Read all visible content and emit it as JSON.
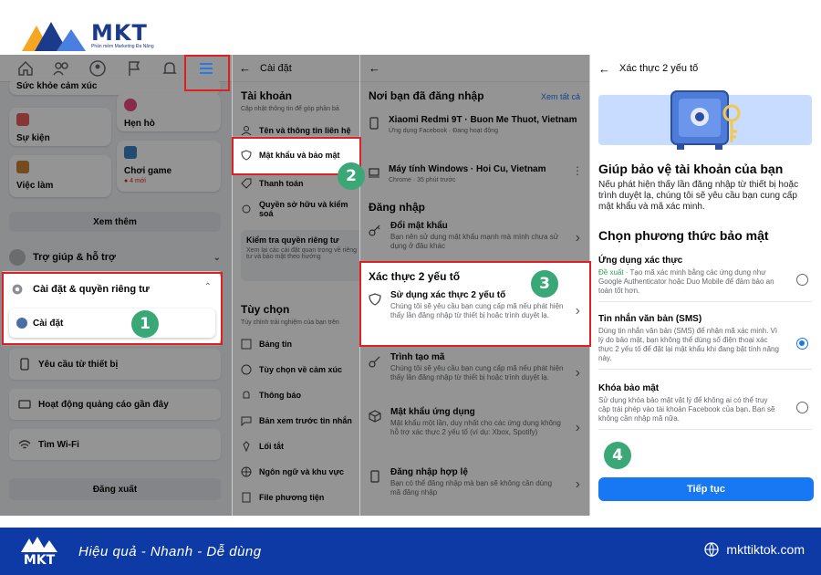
{
  "brand": {
    "logo_word": "MKT",
    "logo_sub": "Phần mềm Marketing Đa Năng",
    "slogan": "Hiệu quả - Nhanh - Dễ dùng",
    "website": "mkttiktok.com",
    "colors": {
      "primary": "#1b3a8c",
      "footer": "#0e3aa6",
      "accent": "#f5a623",
      "highlight": "#e02020",
      "badge": "#3aa876",
      "fb_blue": "#1877f2"
    }
  },
  "panel1": {
    "cards": {
      "health": "Sức khỏe cảm xúc",
      "dating": "Hẹn hò",
      "events": "Sự kiện",
      "jobs": "Việc làm",
      "gaming": "Chơi game",
      "gaming_sub": "● 4 mới"
    },
    "see_more": "Xem thêm",
    "help": "Trợ giúp & hỗ trợ",
    "settings_privacy": "Cài đặt & quyền riêng tư",
    "settings": "Cài đặt",
    "device_requests": "Yêu cầu từ thiết bị",
    "ad_activity": "Hoạt động quảng cáo gần đây",
    "find_wifi": "Tìm Wi-Fi",
    "logout": "Đăng xuất"
  },
  "panel2": {
    "header": "Cài đặt",
    "account_title": "Tài khoản",
    "account_sub": "Cập nhật thông tin để góp phần bả",
    "items": [
      "Tên và thông tin liên hệ",
      "Mật khẩu và bảo mật",
      "Thanh toán",
      "Quyền sở hữu và kiểm soá"
    ],
    "privacy_box_title": "Kiểm tra quyền riêng tư",
    "privacy_box_desc": "Xem lại các cài đặt quan trọng về riêng tư và bảo mật theo hướng",
    "prefs_title": "Tùy chọn",
    "prefs_sub": "Tùy chỉnh trải nghiệm của bạn trên",
    "pref_items": [
      "Bảng tin",
      "Tùy chọn về cảm xúc",
      "Thông báo",
      "Bản xem trước tin nhắn",
      "Lối tắt",
      "Ngôn ngữ và khu vực",
      "File phương tiện"
    ]
  },
  "panel3": {
    "logged_in_title": "Nơi bạn đã đăng nhập",
    "see_all": "Xem tất cả",
    "devices": [
      {
        "name": "Xiaomi Redmi 9T · Buon Me Thuot, Vietnam",
        "detail": "Ứng dụng Facebook · Đang hoạt động"
      },
      {
        "name": "Máy tính Windows · Hoi Cu, Vietnam",
        "detail": "Chrome · 35 phút trước"
      }
    ],
    "login_title": "Đăng nhập",
    "change_password": "Đổi mật khẩu",
    "change_password_desc": "Bạn nên sử dụng mật khẩu mạnh mà mình chưa sử dụng ở đâu khác",
    "twofa_title": "Xác thực 2 yếu tố",
    "use_2fa": "Sử dụng xác thực 2 yếu tố",
    "use_2fa_desc": "Chúng tôi sẽ yêu cầu bạn cung cấp mã nếu phát hiện thấy lần đăng nhập từ thiết bị hoặc trình duyệt lạ.",
    "code_gen": "Trình tạo mã",
    "code_gen_desc": "Chúng tôi sẽ yêu cầu bạn cung cấp mã nếu phát hiện thấy lần đăng nhập từ thiết bị hoặc trình duyệt lạ.",
    "app_password": "Mật khẩu ứng dụng",
    "app_password_desc": "Mật khẩu một lần, duy nhất cho các ứng dụng không hỗ trợ xác thực 2 yếu tố (ví dụ: Xbox, Spotify)",
    "saved_login": "Đăng nhập hợp lệ",
    "saved_login_desc": "Bạn có thể đăng nhập mà bạn sẽ không cần dùng mã đăng nhập"
  },
  "panel4": {
    "header": "Xác thực 2 yếu tố",
    "heading": "Giúp bảo vệ tài khoản của bạn",
    "intro": "Nếu phát hiện thấy lần đăng nhập từ thiết bị hoặc trình duyệt lạ, chúng tôi sẽ yêu cầu bạn cung cấp mật khẩu và mã xác minh.",
    "choose_title": "Chọn phương thức bảo mật",
    "methods": [
      {
        "title": "Ứng dụng xác thực",
        "recommended": "Đề xuất",
        "desc": " · Tạo mã xác minh bằng các ứng dụng như Google Authenticator hoặc Duo Mobile để đảm bảo an toàn tốt hơn.",
        "selected": false
      },
      {
        "title": "Tin nhắn văn bản (SMS)",
        "desc": "Dùng tin nhắn văn bản (SMS) để nhận mã xác minh. Vì lý do bảo mật, bạn không thể dùng số điện thoại xác thực 2 yếu tố để đặt lại mật khẩu khi đang bật tính năng này.",
        "selected": true
      },
      {
        "title": "Khóa bảo mật",
        "desc": "Sử dụng khóa bảo mật vật lý để không ai có thể truy cập trái phép vào tài khoản Facebook của bạn. Bạn sẽ không cần nhập mã nữa.",
        "selected": false
      }
    ],
    "continue": "Tiếp tục"
  },
  "steps": [
    "1",
    "2",
    "3",
    "4"
  ],
  "icons": [
    "home-icon",
    "friends-icon",
    "groups-icon",
    "flag-icon",
    "bell-icon",
    "menu-icon",
    "back-arrow-icon",
    "shield-icon",
    "phone-icon",
    "laptop-icon",
    "key-icon",
    "cube-icon",
    "chevron-right-icon",
    "chevron-down-icon",
    "gear-icon",
    "globe-icon",
    "safe-icon"
  ]
}
